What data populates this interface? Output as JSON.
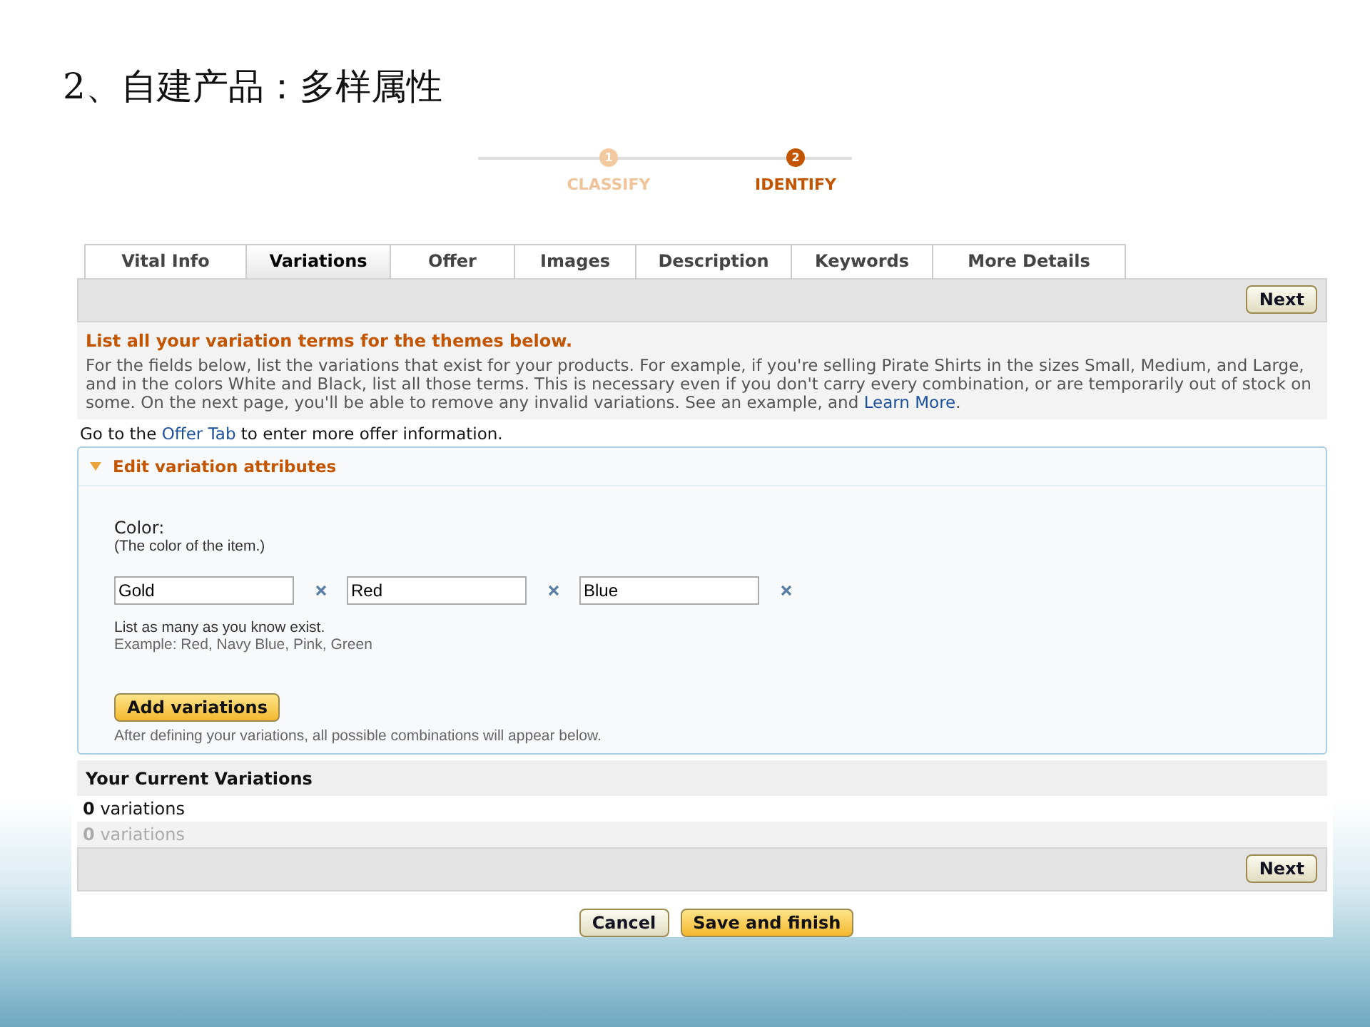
{
  "slide_title": "2、自建产品：多样属性",
  "steps": [
    {
      "number": "1",
      "label": "CLASSIFY",
      "selected": false
    },
    {
      "number": "2",
      "label": "IDENTIFY",
      "selected": true
    }
  ],
  "tabs": [
    {
      "label": "Vital Info",
      "selected": false
    },
    {
      "label": "Variations",
      "selected": true
    },
    {
      "label": "Offer",
      "selected": false
    },
    {
      "label": "Images",
      "selected": false
    },
    {
      "label": "Description",
      "selected": false
    },
    {
      "label": "Keywords",
      "selected": false
    },
    {
      "label": "More Details",
      "selected": false
    }
  ],
  "top_bar": {
    "button": "Next"
  },
  "intro": {
    "heading": "List all your variation terms for the themes below.",
    "text": "For the fields below, list the variations that exist for your products. For example, if you're selling Pirate Shirts in the sizes Small, Medium, and Large, and in the colors White and Black, list all those terms. This is necessary even if you don't carry every combination, or are temporarily out of stock on some. On the next page, you'll be able to remove any invalid variations. See an example, and ",
    "link": "Learn More",
    "end": "."
  },
  "offer_line": {
    "before": "Go to the ",
    "link": "Offer Tab",
    "after": " to enter more offer information."
  },
  "section": {
    "title": "Edit variation attributes",
    "expanded": true,
    "attribute": "Color:",
    "hint": "(The color of the item.)",
    "values": [
      "Gold",
      "Red",
      "Blue"
    ],
    "help": "List as many as you know exist.",
    "example": "Example: Red, Navy Blue, Pink, Green",
    "add_button": "Add variations",
    "note": "After defining your variations, all possible combinations will appear below."
  },
  "current": {
    "heading": "Your Current Variations",
    "rows": [
      {
        "count": "0",
        "label": "variations",
        "dimmed": false
      },
      {
        "count": "0",
        "label": "variations",
        "dimmed": true
      }
    ]
  },
  "bottom_bar": {
    "button": "Next"
  },
  "footer": [
    {
      "label": "Cancel",
      "kind": "secondary"
    },
    {
      "label": "Save and finish",
      "kind": "primary"
    }
  ]
}
